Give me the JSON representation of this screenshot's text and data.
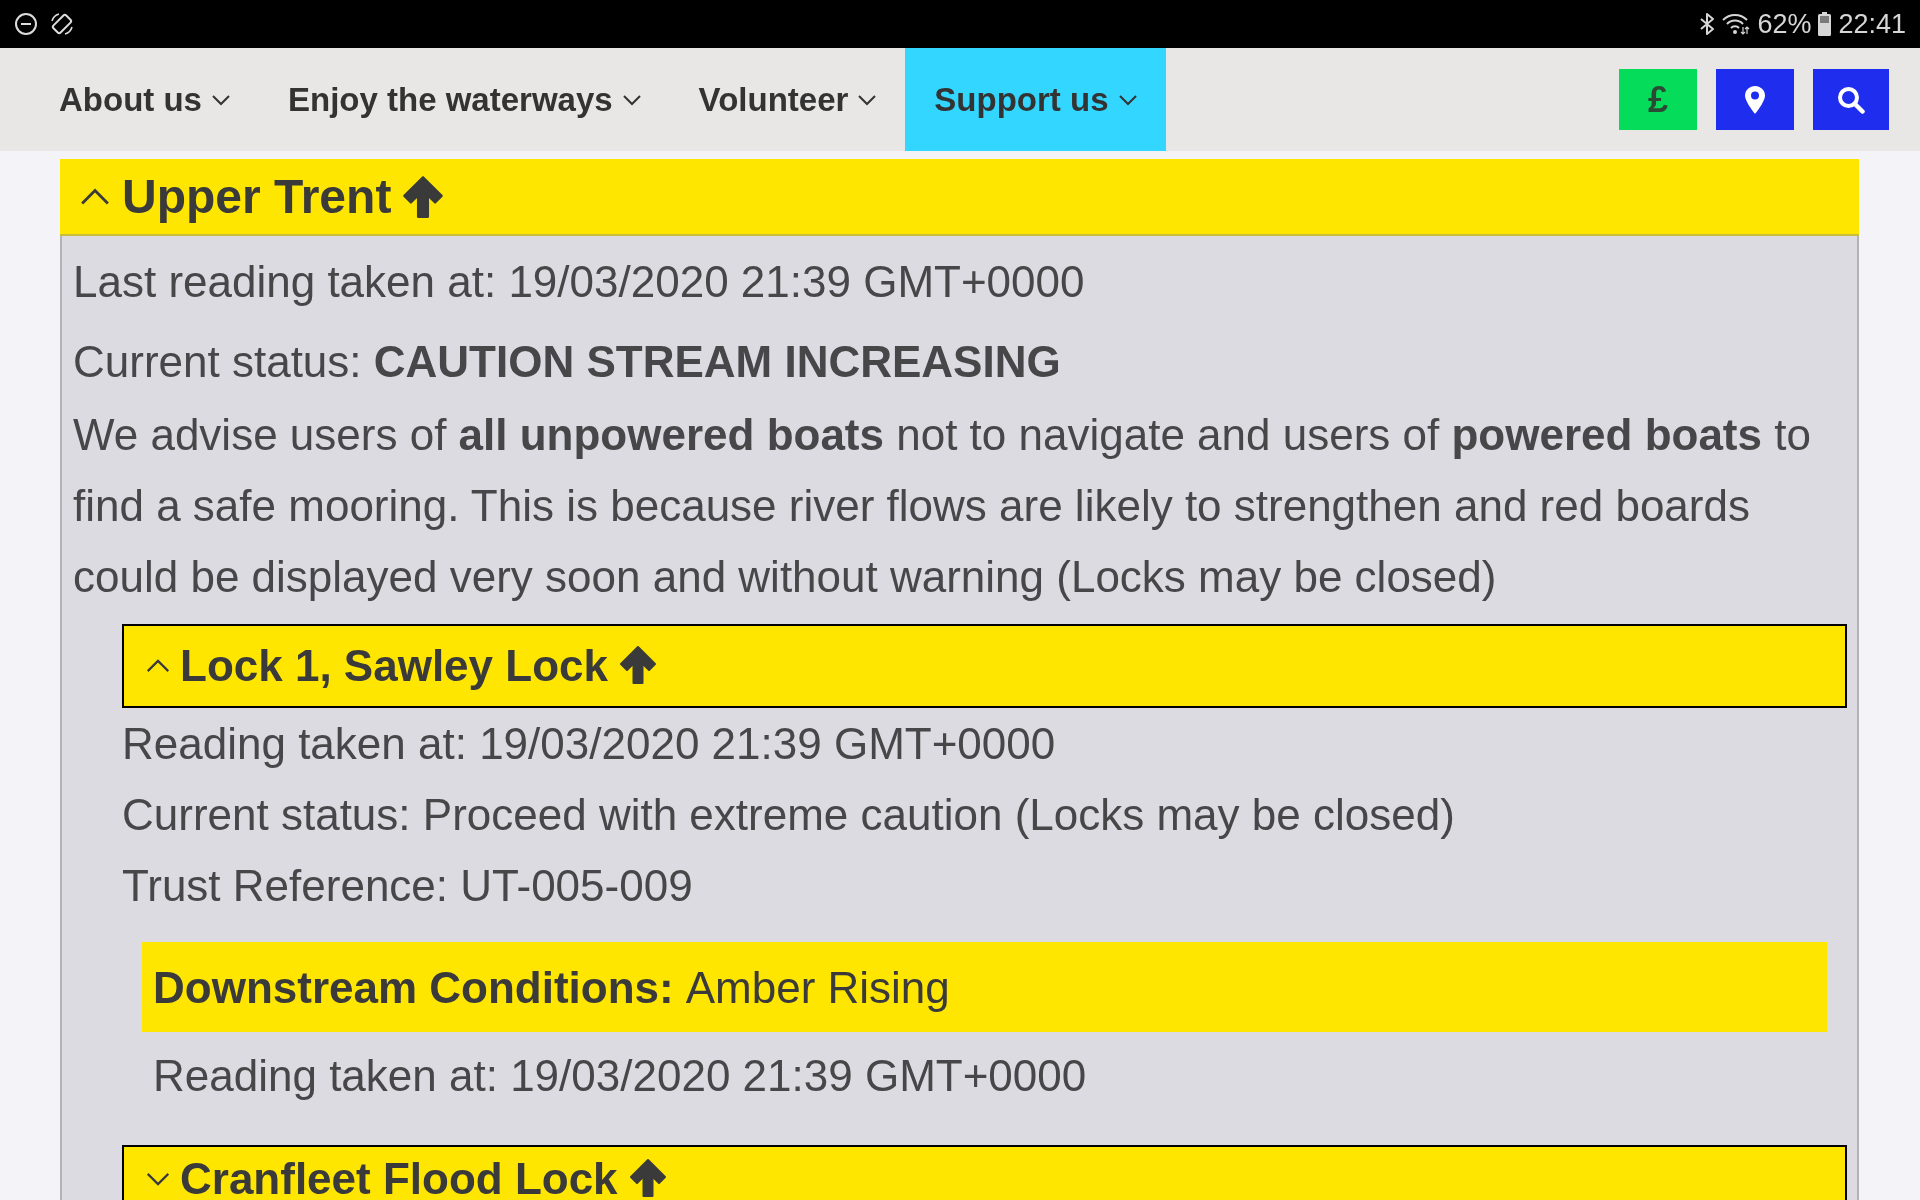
{
  "status_bar": {
    "battery": "62%",
    "time": "22:41"
  },
  "nav": {
    "items": [
      {
        "label": "About us",
        "selected": false
      },
      {
        "label": "Enjoy the waterways",
        "selected": false
      },
      {
        "label": "Volunteer",
        "selected": false
      },
      {
        "label": "Support us",
        "selected": true
      }
    ],
    "actions": [
      {
        "kind": "donate",
        "label": "£"
      },
      {
        "kind": "location"
      },
      {
        "kind": "search"
      }
    ]
  },
  "regions": [
    {
      "title": "Upper Trent",
      "expanded": true,
      "rising": true,
      "reading": "Last reading taken at: 19/03/2020 21:39 GMT+0000",
      "status": "Current status: **CAUTION STREAM INCREASING**",
      "advice": "We advise users of **all unpowered boats** not to navigate and users of **powered boats** to find a safe mooring. This is because river flows are likely to strengthen and red boards could be displayed very soon and without warning (Locks may be closed)",
      "locks": [
        {
          "title": "Lock 1, Sawley Lock",
          "expanded": true,
          "rising": true,
          "lines": [
            "Reading taken at: 19/03/2020 21:39 GMT+0000",
            "Current status: Proceed with extreme caution (Locks may be closed)",
            "Trust Reference: UT-005-009"
          ],
          "conditions": [
            {
              "label": "Downstream Conditions:",
              "value": "Amber Rising",
              "reading": "Reading taken at: 19/03/2020 21:39 GMT+0000"
            }
          ]
        },
        {
          "title": "Cranfleet Flood Lock",
          "expanded": false,
          "rising": true
        }
      ]
    }
  ]
}
